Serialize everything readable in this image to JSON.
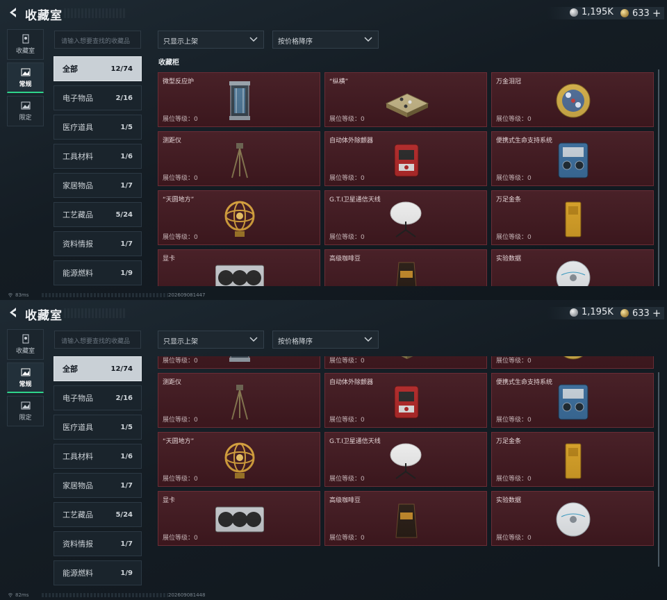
{
  "app": {
    "title": "收藏室",
    "currency": {
      "silver": "1,195K",
      "gold": "633",
      "gold_plus": "+"
    }
  },
  "side_tabs": [
    {
      "label": "收藏室",
      "icon": "showcase-icon"
    },
    {
      "label": "常规",
      "icon": "photo-icon"
    },
    {
      "label": "限定",
      "icon": "limited-icon"
    }
  ],
  "search": {
    "placeholder": "请输入想要查找的收藏品"
  },
  "filters": {
    "display": "只显示上架",
    "sort": "按价格降序"
  },
  "categories": [
    {
      "label": "全部",
      "count": "12/74"
    },
    {
      "label": "电子物品",
      "count": "2/16"
    },
    {
      "label": "医疗道具",
      "count": "1/5"
    },
    {
      "label": "工具材料",
      "count": "1/6"
    },
    {
      "label": "家居物品",
      "count": "1/7"
    },
    {
      "label": "工艺藏品",
      "count": "5/24"
    },
    {
      "label": "资料情报",
      "count": "1/7"
    },
    {
      "label": "能源燃料",
      "count": "1/9"
    }
  ],
  "section_title": "收藏柜",
  "level_label": "展位等级：0",
  "items": [
    {
      "name": "微型反应炉",
      "icon": "reactor-icon"
    },
    {
      "name": "“纵横”",
      "icon": "chessboard-icon"
    },
    {
      "name": "万金泪冠",
      "icon": "jeweled-crown-icon"
    },
    {
      "name": "测距仪",
      "icon": "tripod-rangefinder-icon"
    },
    {
      "name": "自动体外除颤器",
      "icon": "defibrillator-icon"
    },
    {
      "name": "便携式生命支持系统",
      "icon": "life-support-icon"
    },
    {
      "name": "“天圆地方”",
      "icon": "armillary-sphere-icon"
    },
    {
      "name": "G.T.I卫星通信天线",
      "icon": "satellite-dish-icon"
    },
    {
      "name": "万足金条",
      "icon": "gold-bar-icon"
    },
    {
      "name": "显卡",
      "icon": "graphics-card-icon"
    },
    {
      "name": "高级咖啡豆",
      "icon": "coffee-bag-icon"
    },
    {
      "name": "实验数据",
      "icon": "data-disc-icon"
    }
  ],
  "status": [
    {
      "ping": "83ms",
      "timestamp": "202609081447"
    },
    {
      "ping": "82ms",
      "timestamp": "202609081448"
    }
  ],
  "colors": {
    "accent": "#2fd48b",
    "card_bg": "#431a21",
    "card_border": "#6a2d36"
  }
}
